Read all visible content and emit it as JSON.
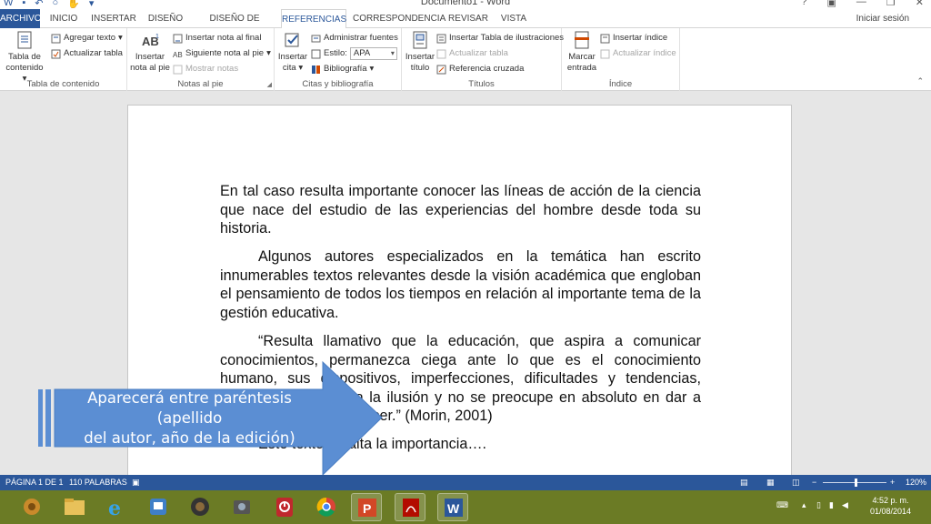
{
  "titlebar": {
    "title": "Documento1 - Word",
    "help": "?",
    "minimize": "—",
    "restore": "❐",
    "close": "✕"
  },
  "tabs": {
    "file": "ARCHIVO",
    "items": [
      "INICIO",
      "INSERTAR",
      "DISEÑO",
      "DISEÑO DE PÁGINA",
      "REFERENCIAS",
      "CORRESPONDENCIA",
      "REVISAR",
      "VISTA"
    ],
    "active": "REFERENCIAS",
    "signin": "Iniciar sesión"
  },
  "ribbon": {
    "toc": {
      "big_label_1": "Tabla de",
      "big_label_2": "contenido",
      "add_text": "Agregar texto",
      "update_table": "Actualizar tabla",
      "group": "Tabla de contenido"
    },
    "footnotes": {
      "big_label_1": "Insertar",
      "big_label_2": "nota al pie",
      "insert_endnote": "Insertar nota al final",
      "next_footnote": "Siguiente nota al pie",
      "show_notes": "Mostrar notas",
      "group": "Notas al pie"
    },
    "citations": {
      "big_label_1": "Insertar",
      "big_label_2": "cita",
      "manage_sources": "Administrar fuentes",
      "style_label": "Estilo:",
      "style_value": "APA",
      "bibliography": "Bibliografía",
      "group": "Citas y bibliografía"
    },
    "captions": {
      "big_label_1": "Insertar",
      "big_label_2": "título",
      "insert_table_figures": "Insertar Tabla de ilustraciones",
      "update_table": "Actualizar tabla",
      "cross_reference": "Referencia cruzada",
      "group": "Títulos"
    },
    "index": {
      "big_label_1": "Marcar",
      "big_label_2": "entrada",
      "insert_index": "Insertar índice",
      "update_index": "Actualizar índice",
      "group": "Índice"
    }
  },
  "document": {
    "paragraphs": [
      "En tal caso resulta importante conocer las líneas de acción de la ciencia que nace del estudio de las experiencias del hombre desde toda su historia.",
      "Algunos autores especializados en la temática han escrito innumerables textos relevantes desde la visión académica que engloban el pensamiento de todos los tiempos en relación al importante tema de la gestión educativa.",
      "“Resulta llamativo que la educación, que aspira a comunicar conocimientos, permanezca ciega ante lo que es el conocimiento humano, sus dispositivos, imperfecciones, dificultades y tendencias, tanto al error como a la ilusión y no se preocupe en absoluto en dar a conocer lo que es conocer.” (Morin, 2001)",
      "Este texto resalta la importancia…."
    ]
  },
  "callout": {
    "line1": "Aparecerá entre paréntesis (apellido",
    "line2": "del autor, año de la edición)",
    "color": "#5b8ed3"
  },
  "statusbar": {
    "page": "PÁGINA 1 DE 1",
    "words": "110 PALABRAS",
    "zoom_minus": "−",
    "zoom_plus": "+",
    "zoom": "120%",
    "color": "#2b579a"
  },
  "taskbar": {
    "time": "4:52 p. m.",
    "date": "01/08/2014",
    "apps": [
      "media-player-icon",
      "file-explorer-icon",
      "internet-explorer-icon",
      "monitor-icon",
      "speaker-icon",
      "camera-icon",
      "power-icon",
      "chrome-icon",
      "powerpoint-icon",
      "acrobat-icon",
      "word-icon"
    ]
  }
}
